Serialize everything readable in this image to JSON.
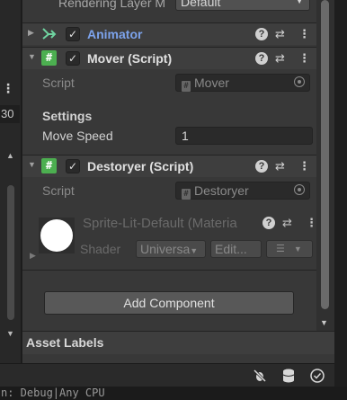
{
  "left_panel": {
    "overflow_icon": "⋮",
    "value_text": "30"
  },
  "inspector": {
    "rendering_layer": {
      "label": "Rendering Layer M",
      "value": "Default"
    },
    "animator": {
      "title": "Animator",
      "enabled": true,
      "icon": "animator-icon"
    },
    "mover": {
      "title": "Mover (Script)",
      "enabled": true,
      "script_label": "Script",
      "script_value": "Mover",
      "settings_header": "Settings",
      "move_speed_label": "Move Speed",
      "move_speed_value": "1"
    },
    "destoryer": {
      "title": "Destoryer (Script)",
      "enabled": true,
      "script_label": "Script",
      "script_value": "Destoryer"
    },
    "material": {
      "title": "Sprite-Lit-Default (Materia",
      "shader_label": "Shader",
      "shader_value": "Universa",
      "edit_label": "Edit..."
    },
    "add_component_label": "Add Component",
    "asset_labels_header": "Asset Labels"
  },
  "header_tools": {
    "help": "?",
    "presets": "⇄",
    "menu": "⋮"
  },
  "statusbar_icons": [
    "debug-off-icon",
    "cache-server-icon",
    "check-circle-icon"
  ],
  "terminal_text": "n: Debug|Any CPU",
  "colors": {
    "panel_bg": "#383838",
    "header_bg": "#3e3e3e",
    "script_icon": "#4caf50",
    "animator_blue": "#7ca3ec"
  }
}
